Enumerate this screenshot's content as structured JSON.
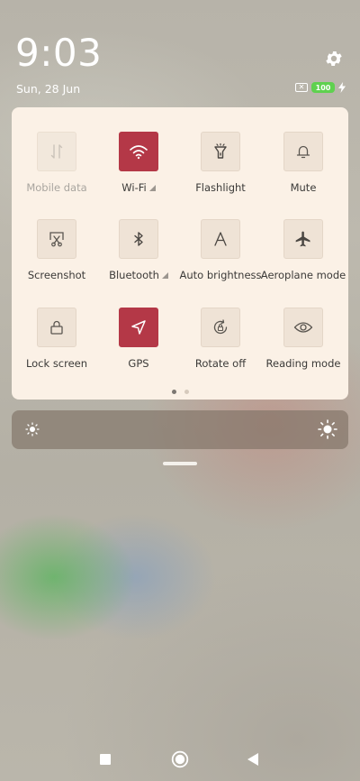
{
  "status_bar": {
    "time": "9:03",
    "date": "Sun, 28 Jun",
    "battery_level": "100",
    "icons": [
      "no-sim-icon",
      "battery-icon",
      "charging-bolt-icon",
      "gear-icon"
    ]
  },
  "colors": {
    "panel_bg": "#fbf1e6",
    "tile_bg": "#efe3d6",
    "tile_active": "#b43847",
    "battery": "#5fd14f"
  },
  "quick_settings": {
    "tiles": [
      {
        "label": "Mobile data",
        "icon": "mobile-data-icon",
        "state": "disabled"
      },
      {
        "label": "Wi-Fi",
        "icon": "wifi-icon",
        "state": "active",
        "expandable": true
      },
      {
        "label": "Flashlight",
        "icon": "flashlight-icon",
        "state": "off"
      },
      {
        "label": "Mute",
        "icon": "bell-icon",
        "state": "off"
      },
      {
        "label": "Screenshot",
        "icon": "screenshot-icon",
        "state": "off"
      },
      {
        "label": "Bluetooth",
        "icon": "bluetooth-icon",
        "state": "off",
        "expandable": true
      },
      {
        "label": "Auto brightness",
        "icon": "auto-brightness-icon",
        "state": "off"
      },
      {
        "label": "Aeroplane mode",
        "icon": "airplane-icon",
        "state": "off"
      },
      {
        "label": "Lock screen",
        "icon": "lock-icon",
        "state": "off"
      },
      {
        "label": "GPS",
        "icon": "location-arrow-icon",
        "state": "active"
      },
      {
        "label": "Rotate off",
        "icon": "rotate-lock-icon",
        "state": "off"
      },
      {
        "label": "Reading mode",
        "icon": "eye-icon",
        "state": "off"
      }
    ],
    "page_indicator": {
      "current": 1,
      "total": 2
    }
  },
  "brightness": {
    "icons": [
      "sun-small-icon",
      "sun-large-icon"
    ]
  },
  "nav_bar": {
    "buttons": [
      "recents-button",
      "home-button",
      "back-button"
    ]
  }
}
